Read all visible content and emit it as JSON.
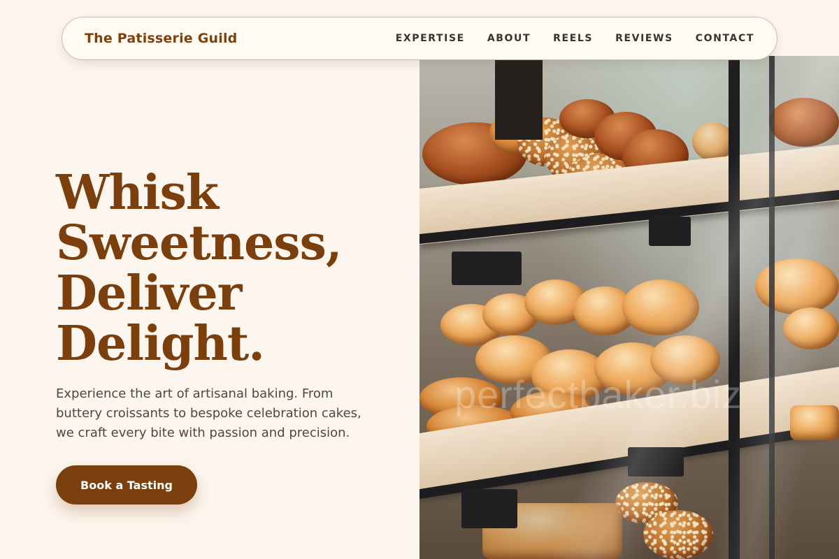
{
  "brand": {
    "name": "The Patisserie Guild"
  },
  "nav": {
    "items": [
      {
        "label": "EXPERTISE"
      },
      {
        "label": "ABOUT"
      },
      {
        "label": "REELS"
      },
      {
        "label": "REVIEWS"
      },
      {
        "label": "CONTACT"
      }
    ]
  },
  "hero": {
    "title_lines": [
      "Whisk",
      "Sweetness,",
      "Deliver",
      "Delight."
    ],
    "subtitle": "Experience the art of artisanal baking. From buttery croissants to bespoke celebration cakes, we craft every bite with passion and precision.",
    "cta_label": "Book a Tasting",
    "image_watermark": "perfectbaker.biz"
  },
  "colors": {
    "background": "#fdf6ee",
    "accent": "#7a3f0c",
    "nav_text": "#3a3330",
    "body_text": "#4d4643"
  }
}
